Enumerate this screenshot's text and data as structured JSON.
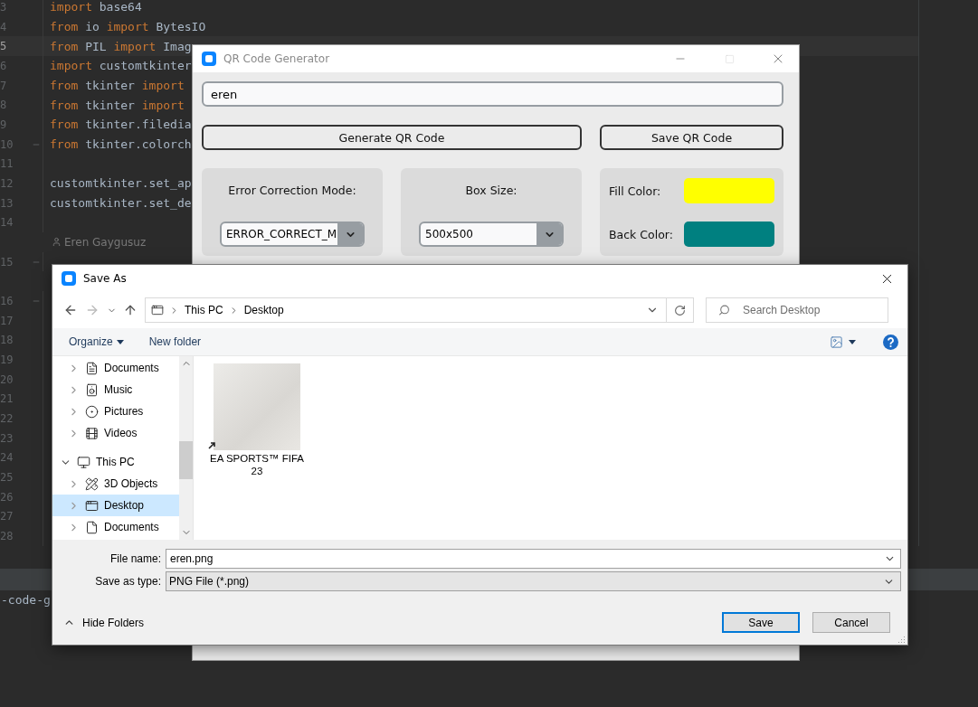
{
  "editor": {
    "lines": [
      {
        "kind": "code",
        "number": "3",
        "current": false,
        "fold": false,
        "tokens": [
          {
            "kind": "keyword",
            "text": "import"
          },
          {
            "kind": "plain",
            "text": " base64"
          }
        ]
      },
      {
        "kind": "code",
        "number": "4",
        "current": false,
        "fold": false,
        "tokens": [
          {
            "kind": "keyword",
            "text": "from"
          },
          {
            "kind": "plain",
            "text": " io "
          },
          {
            "kind": "keyword",
            "text": "import"
          },
          {
            "kind": "plain",
            "text": " BytesIO"
          }
        ]
      },
      {
        "kind": "code",
        "number": "5",
        "current": true,
        "fold": false,
        "tokens": [
          {
            "kind": "keyword",
            "text": "from"
          },
          {
            "kind": "plain",
            "text": " PIL "
          },
          {
            "kind": "keyword",
            "text": "import"
          },
          {
            "kind": "plain",
            "text": " Imag"
          }
        ]
      },
      {
        "kind": "code",
        "number": "6",
        "current": false,
        "fold": false,
        "tokens": [
          {
            "kind": "keyword",
            "text": "import"
          },
          {
            "kind": "plain",
            "text": " customtkinter"
          }
        ]
      },
      {
        "kind": "code",
        "number": "7",
        "current": false,
        "fold": false,
        "tokens": [
          {
            "kind": "keyword",
            "text": "from"
          },
          {
            "kind": "plain",
            "text": " tkinter "
          },
          {
            "kind": "keyword",
            "text": "import"
          }
        ]
      },
      {
        "kind": "code",
        "number": "8",
        "current": false,
        "fold": false,
        "tokens": [
          {
            "kind": "keyword",
            "text": "from"
          },
          {
            "kind": "plain",
            "text": " tkinter "
          },
          {
            "kind": "keyword",
            "text": "import"
          }
        ]
      },
      {
        "kind": "code",
        "number": "9",
        "current": false,
        "fold": false,
        "tokens": [
          {
            "kind": "keyword",
            "text": "from"
          },
          {
            "kind": "plain",
            "text": " tkinter.filedia"
          }
        ]
      },
      {
        "kind": "code",
        "number": "10",
        "current": false,
        "fold": true,
        "tokens": [
          {
            "kind": "keyword",
            "text": "from"
          },
          {
            "kind": "plain",
            "text": " tkinter.colorch"
          }
        ]
      },
      {
        "kind": "code",
        "number": "11",
        "current": false,
        "fold": false
      },
      {
        "kind": "code",
        "number": "12",
        "current": false,
        "fold": false,
        "tokens": [
          {
            "kind": "plain",
            "text": "customtkinter.set_ap"
          }
        ]
      },
      {
        "kind": "code",
        "number": "13",
        "current": false,
        "fold": false,
        "tokens": [
          {
            "kind": "plain",
            "text": "customtkinter.set_de"
          }
        ]
      },
      {
        "kind": "code",
        "number": "14",
        "current": false,
        "fold": false
      },
      {
        "kind": "hint",
        "author": "Eren Gaygusuz"
      },
      {
        "kind": "code",
        "number": "15",
        "current": false,
        "fold": true
      },
      {
        "kind": "spacer"
      },
      {
        "kind": "code",
        "number": "16",
        "current": false,
        "fold": true
      },
      {
        "kind": "code",
        "number": "17",
        "current": false,
        "fold": false
      },
      {
        "kind": "code",
        "number": "18",
        "current": false,
        "fold": false
      },
      {
        "kind": "code",
        "number": "19",
        "current": false,
        "fold": false
      },
      {
        "kind": "code",
        "number": "20",
        "current": false,
        "fold": false
      },
      {
        "kind": "code",
        "number": "21",
        "current": false,
        "fold": false
      },
      {
        "kind": "code",
        "number": "22",
        "current": false,
        "fold": false
      },
      {
        "kind": "code",
        "number": "23",
        "current": false,
        "fold": false
      },
      {
        "kind": "code",
        "number": "24",
        "current": false,
        "fold": false
      },
      {
        "kind": "code",
        "number": "25",
        "current": false,
        "fold": false
      },
      {
        "kind": "code",
        "number": "26",
        "current": false,
        "fold": false
      },
      {
        "kind": "code",
        "number": "27",
        "current": false,
        "fold": false
      },
      {
        "kind": "code",
        "number": "28",
        "current": false,
        "fold": false
      }
    ],
    "terminal": {
      "text": "-code-g"
    }
  },
  "qr_window": {
    "title": "QR Code Generator",
    "text_entry": {
      "value": "eren"
    },
    "buttons": [
      {
        "label": "Generate QR Code"
      },
      {
        "label": "Save QR Code"
      }
    ],
    "error_correction": {
      "label": "Error Correction Mode:",
      "value": "ERROR_CORRECT_M"
    },
    "box_size": {
      "label": "Box Size:",
      "value": "500x500"
    },
    "colors": [
      {
        "label": "Fill Color:",
        "color": "#ffff00"
      },
      {
        "label": "Back Color:",
        "color": "#008080"
      }
    ]
  },
  "save_dialog": {
    "title": "Save As",
    "breadcrumb": [
      "This PC",
      "Desktop"
    ],
    "search": {
      "placeholder": "Search Desktop"
    },
    "toolbar": [
      {
        "label": "Organize",
        "kind": "menu"
      },
      {
        "label": "New folder",
        "kind": "plain"
      }
    ],
    "tree": [
      {
        "label": "Documents",
        "kind": "documents",
        "expanded": false,
        "selected": false
      },
      {
        "label": "Music",
        "kind": "music",
        "expanded": false,
        "selected": false
      },
      {
        "label": "Pictures",
        "kind": "pictures",
        "expanded": false,
        "selected": false
      },
      {
        "label": "Videos",
        "kind": "videos",
        "expanded": false,
        "selected": false
      },
      {
        "label": "This PC",
        "kind": "computer",
        "expanded": true,
        "selected": false,
        "children": [
          {
            "label": "3D Objects",
            "kind": "objects",
            "expanded": false,
            "selected": false
          },
          {
            "label": "Desktop",
            "kind": "desktop",
            "expanded": false,
            "selected": true
          },
          {
            "label": "Documents",
            "kind": "file",
            "expanded": false,
            "selected": false
          }
        ]
      }
    ],
    "files": [
      {
        "name": "EA SPORTS™ FIFA 23",
        "kind": "shortcut"
      }
    ],
    "file_name": {
      "label": "File name:",
      "value": "eren.png"
    },
    "save_type": {
      "label": "Save as type:",
      "value": "PNG File (*.png)"
    },
    "hide_folders": "Hide Folders",
    "buttons": [
      {
        "label": "Save",
        "kind": "primary"
      },
      {
        "label": "Cancel",
        "kind": "normal"
      }
    ]
  }
}
